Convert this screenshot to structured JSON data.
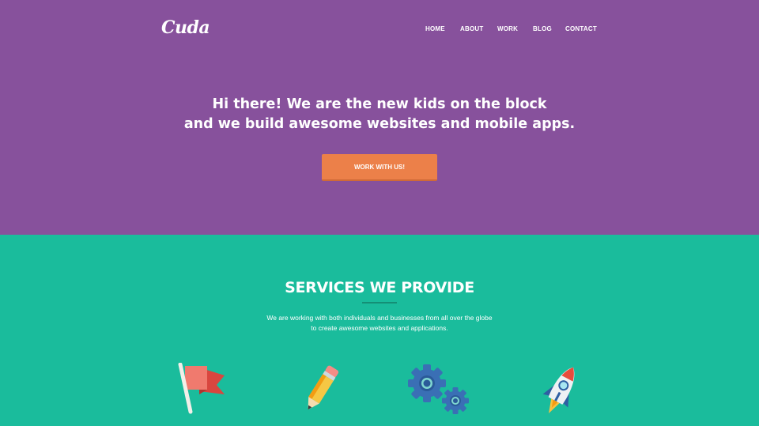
{
  "brand": {
    "logo": "Cuda"
  },
  "nav": {
    "items": [
      "HOME",
      "ABOUT",
      "WORK",
      "BLOG",
      "CONTACT"
    ]
  },
  "hero": {
    "line1": "Hi there! We are the new kids on the block",
    "line2": "and we build awesome websites and mobile apps.",
    "cta_label": "WORK WITH US!"
  },
  "services": {
    "title": "SERVICES WE PROVIDE",
    "desc_line1": "We are working with both individuals and businesses from all over the globe",
    "desc_line2": "to create awesome websites and applications.",
    "icons": [
      "flag-icon",
      "pencil-icon",
      "gears-icon",
      "rocket-icon"
    ]
  },
  "colors": {
    "hero_bg": "#87519c",
    "services_bg": "#1abc9c",
    "accent": "#ec8049"
  }
}
